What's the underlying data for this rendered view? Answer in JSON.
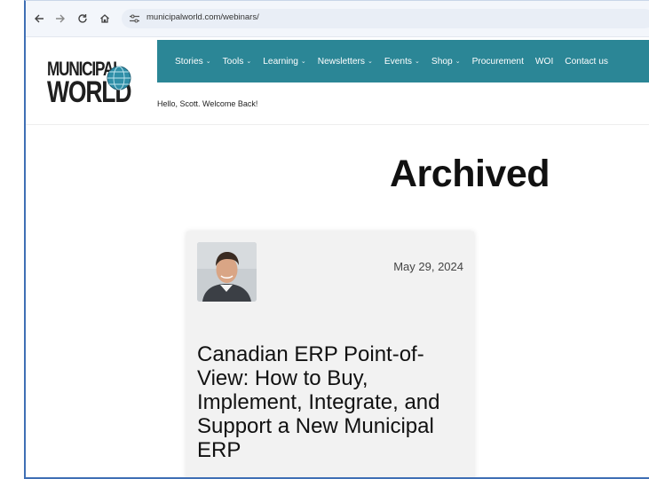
{
  "browser": {
    "url": "municipalworld.com/webinars/"
  },
  "site": {
    "logo_line1": "MUNICIPAL",
    "logo_line2": "WORLD",
    "nav": [
      {
        "label": "Stories",
        "has_menu": true
      },
      {
        "label": "Tools",
        "has_menu": true
      },
      {
        "label": "Learning",
        "has_menu": true
      },
      {
        "label": "Newsletters",
        "has_menu": true
      },
      {
        "label": "Events",
        "has_menu": true
      },
      {
        "label": "Shop",
        "has_menu": true
      },
      {
        "label": "Procurement",
        "has_menu": false
      },
      {
        "label": "WOI",
        "has_menu": false
      },
      {
        "label": "Contact us",
        "has_menu": false
      }
    ],
    "welcome": "Hello, Scott. Welcome Back!",
    "brand_color": "#2b8696"
  },
  "main": {
    "title": "Archived",
    "card": {
      "date": "May 29, 2024",
      "title": "Canadian ERP Point-of-View: How to Buy, Implement, Integrate, and Support a New Municipal ERP"
    }
  },
  "icons": {
    "back": "arrow-left-icon",
    "forward": "arrow-right-icon",
    "reload": "reload-icon",
    "home": "home-icon",
    "site_info": "tune-icon"
  }
}
